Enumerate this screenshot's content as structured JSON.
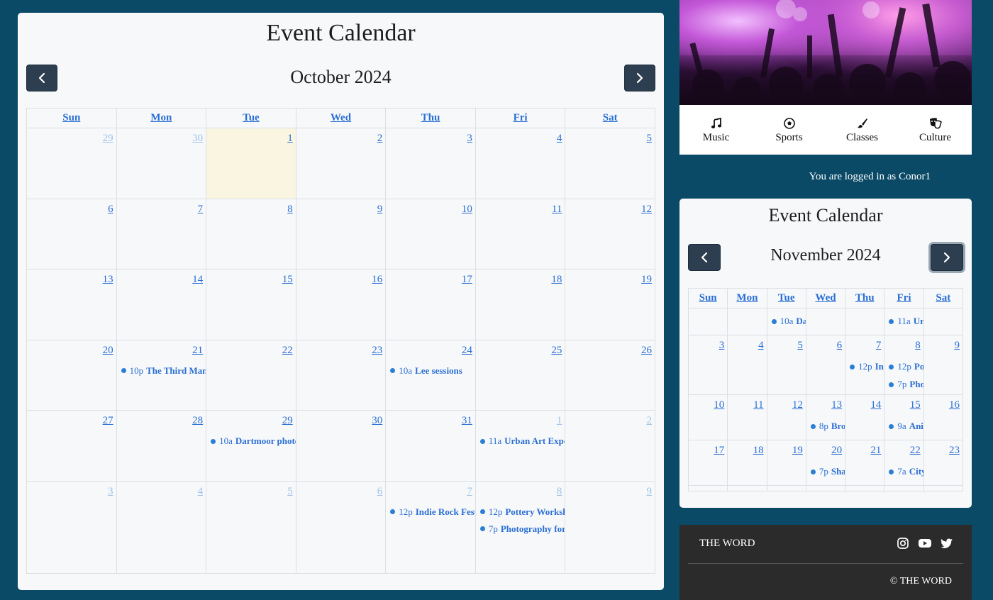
{
  "left_calendar": {
    "title": "Event Calendar",
    "month": "October 2024",
    "weekdays": [
      "Sun",
      "Mon",
      "Tue",
      "Wed",
      "Thu",
      "Fri",
      "Sat"
    ],
    "weeks": [
      [
        {
          "d": "29",
          "other": true
        },
        {
          "d": "30",
          "other": true
        },
        {
          "d": "1",
          "today": true
        },
        {
          "d": "2"
        },
        {
          "d": "3"
        },
        {
          "d": "4"
        },
        {
          "d": "5"
        }
      ],
      [
        {
          "d": "6"
        },
        {
          "d": "7"
        },
        {
          "d": "8"
        },
        {
          "d": "9"
        },
        {
          "d": "10"
        },
        {
          "d": "11"
        },
        {
          "d": "12"
        }
      ],
      [
        {
          "d": "13"
        },
        {
          "d": "14"
        },
        {
          "d": "15"
        },
        {
          "d": "16"
        },
        {
          "d": "17"
        },
        {
          "d": "18"
        },
        {
          "d": "19"
        }
      ],
      [
        {
          "d": "20"
        },
        {
          "d": "21",
          "events": [
            {
              "time": "10p",
              "name": "The Third Man"
            }
          ]
        },
        {
          "d": "22"
        },
        {
          "d": "23"
        },
        {
          "d": "24",
          "events": [
            {
              "time": "10a",
              "name": "Lee sessions"
            }
          ]
        },
        {
          "d": "25"
        },
        {
          "d": "26"
        }
      ],
      [
        {
          "d": "27"
        },
        {
          "d": "28"
        },
        {
          "d": "29",
          "events": [
            {
              "time": "10a",
              "name": "Dartmoor photo"
            }
          ]
        },
        {
          "d": "30"
        },
        {
          "d": "31"
        },
        {
          "d": "1",
          "other": true,
          "events": [
            {
              "time": "11a",
              "name": "Urban Art Expo"
            }
          ]
        },
        {
          "d": "2",
          "other": true
        }
      ],
      [
        {
          "d": "3",
          "other": true
        },
        {
          "d": "4",
          "other": true
        },
        {
          "d": "5",
          "other": true
        },
        {
          "d": "6",
          "other": true
        },
        {
          "d": "7",
          "other": true,
          "events": [
            {
              "time": "12p",
              "name": "Indie Rock Fest"
            }
          ]
        },
        {
          "d": "8",
          "other": true,
          "events": [
            {
              "time": "12p",
              "name": "Pottery Workshop"
            },
            {
              "time": "7p",
              "name": "Photography for"
            }
          ]
        },
        {
          "d": "9",
          "other": true
        }
      ]
    ]
  },
  "categories": [
    {
      "label": "Music",
      "icon": "music-icon"
    },
    {
      "label": "Sports",
      "icon": "soccer-ball-icon"
    },
    {
      "label": "Classes",
      "icon": "paintbrush-icon"
    },
    {
      "label": "Culture",
      "icon": "theater-masks-icon"
    }
  ],
  "login_text": "You are logged in as Conor1",
  "right_calendar": {
    "title": "Event Calendar",
    "month": "November 2024",
    "weekdays": [
      "Sun",
      "Mon",
      "Tue",
      "Wed",
      "Thu",
      "Fri",
      "Sat"
    ],
    "weeks": [
      [
        {
          "d": ""
        },
        {
          "d": ""
        },
        {
          "d": "",
          "events": [
            {
              "time": "10a",
              "name": "Da"
            }
          ]
        },
        {
          "d": ""
        },
        {
          "d": ""
        },
        {
          "d": "",
          "events": [
            {
              "time": "11a",
              "name": "Ur"
            }
          ]
        },
        {
          "d": ""
        }
      ],
      [
        {
          "d": "3"
        },
        {
          "d": "4"
        },
        {
          "d": "5"
        },
        {
          "d": "6"
        },
        {
          "d": "7",
          "events": [
            {
              "time": "12p",
              "name": "In"
            }
          ]
        },
        {
          "d": "8",
          "events": [
            {
              "time": "12p",
              "name": "Po"
            },
            {
              "time": "7p",
              "name": "Pho"
            }
          ]
        },
        {
          "d": "9"
        }
      ],
      [
        {
          "d": "10"
        },
        {
          "d": "11"
        },
        {
          "d": "12"
        },
        {
          "d": "13",
          "events": [
            {
              "time": "8p",
              "name": "Bro"
            }
          ]
        },
        {
          "d": "14"
        },
        {
          "d": "15",
          "events": [
            {
              "time": "9a",
              "name": "Ani"
            }
          ]
        },
        {
          "d": "16"
        }
      ],
      [
        {
          "d": "17"
        },
        {
          "d": "18"
        },
        {
          "d": "19"
        },
        {
          "d": "20",
          "events": [
            {
              "time": "7p",
              "name": "Sha"
            }
          ]
        },
        {
          "d": "21"
        },
        {
          "d": "22",
          "events": [
            {
              "time": "7a",
              "name": "City"
            }
          ]
        },
        {
          "d": "23"
        }
      ],
      [
        {
          "d": ""
        },
        {
          "d": ""
        },
        {
          "d": ""
        },
        {
          "d": ""
        },
        {
          "d": ""
        },
        {
          "d": ""
        },
        {
          "d": ""
        }
      ]
    ]
  },
  "footer": {
    "brand": "THE WORD",
    "copyright": "© THE WORD",
    "socials": [
      "instagram-icon",
      "youtube-icon",
      "twitter-icon"
    ]
  },
  "colors": {
    "page_bg": "#0b4a66",
    "nav_button": "#2c3e50",
    "link_blue": "#2a6fd4",
    "today_bg": "#faf5e1",
    "footer_bg": "#2b2b2b"
  }
}
